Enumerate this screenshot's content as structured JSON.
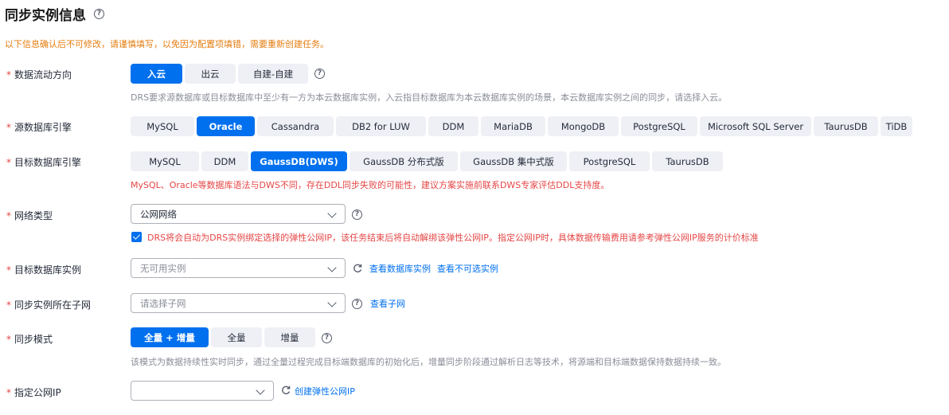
{
  "page": {
    "title": "同步实例信息",
    "notice": "以下信息确认后不可修改，请谨慎填写，以免因为配置项填错，需要重新创建任务。"
  },
  "direction": {
    "label": "数据流动方向",
    "options": [
      "入云",
      "出云",
      "自建-自建"
    ],
    "selected": "入云",
    "hint": "DRS要求源数据库或目标数据库中至少有一方为本云数据库实例，入云指目标数据库为本云数据库实例的场景，本云数据库实例之间的同步，请选择入云。"
  },
  "source_engine": {
    "label": "源数据库引擎",
    "options": [
      "MySQL",
      "Oracle",
      "Cassandra",
      "DB2 for LUW",
      "DDM",
      "MariaDB",
      "MongoDB",
      "PostgreSQL",
      "Microsoft SQL Server",
      "TaurusDB",
      "TiDB"
    ],
    "selected": "Oracle"
  },
  "target_engine": {
    "label": "目标数据库引擎",
    "options": [
      "MySQL",
      "DDM",
      "GaussDB(DWS)",
      "GaussDB 分布式版",
      "GaussDB 集中式版",
      "PostgreSQL",
      "TaurusDB"
    ],
    "selected": "GaussDB(DWS)",
    "warning": "MySQL、Oracle等数据库语法与DWS不同，存在DDL同步失败的可能性，建议方案实施前联系DWS专家评估DDL支持度。"
  },
  "network": {
    "label": "网络类型",
    "value": "公网网络",
    "checkbox_text": "DRS将会自动为DRS实例绑定选择的弹性公网IP，该任务结束后将自动解绑该弹性公网IP。指定公网IP时，具体数据传输费用请参考弹性公网IP服务的计价标准",
    "checkbox_checked": true
  },
  "target_instance": {
    "label": "目标数据库实例",
    "placeholder": "无可用实例",
    "links": [
      "查看数据库实例",
      "查看不可选实例"
    ]
  },
  "subnet": {
    "label": "同步实例所在子网",
    "placeholder": "请选择子网",
    "link": "查看子网"
  },
  "sync_mode": {
    "label": "同步模式",
    "options": [
      "全量 + 增量",
      "全量",
      "增量"
    ],
    "selected": "全量 + 增量",
    "hint": "该模式为数据持续性实时同步，通过全量过程完成目标端数据库的初始化后，增量同步阶段通过解析日志等技术，将源端和目标端数据保持数据持续一致。"
  },
  "public_ip": {
    "label": "指定公网IP",
    "value": "",
    "link": "创建弹性公网IP"
  },
  "icons": {
    "help": "?",
    "required": "*"
  },
  "colors": {
    "accent": "#0070ee",
    "required": "#e54545",
    "notice": "#e57d10",
    "hint": "#8a8e99"
  }
}
